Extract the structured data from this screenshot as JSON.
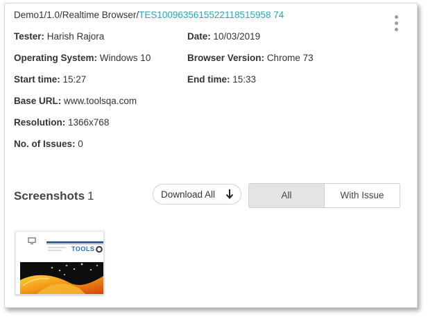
{
  "breadcrumb": {
    "path": "Demo1/1.0/Realtime Browser/",
    "test_id": "TES1009635615522118515958 74"
  },
  "details": {
    "tester": {
      "label": "Tester:",
      "value": "Harish Rajora"
    },
    "date": {
      "label": "Date:",
      "value": "10/03/2019"
    },
    "os": {
      "label": "Operating System:",
      "value": "Windows 10"
    },
    "browser_version": {
      "label": "Browser Version:",
      "value": "Chrome 73"
    },
    "start_time": {
      "label": "Start time:",
      "value": "15:27"
    },
    "end_time": {
      "label": "End time:",
      "value": "15:33"
    },
    "base_url": {
      "label": "Base URL:",
      "value": "www.toolsqa.com"
    },
    "resolution": {
      "label": "Resolution:",
      "value": "1366x768"
    },
    "issues": {
      "label": "No. of Issues:",
      "value": "0"
    }
  },
  "screenshots": {
    "title": "Screenshots",
    "count": "1",
    "download_label": "Download All",
    "filter_all": "All",
    "filter_with_issue": "With Issue",
    "thumbnail_logo_text": "TOOLS"
  },
  "icons": {
    "menu": "kebab-menu-icon",
    "download": "arrow-down-icon",
    "monitor": "monitor-icon"
  },
  "colors": {
    "accent": "#1fa9b8",
    "selected_filter_bg": "#e4e4e4"
  }
}
